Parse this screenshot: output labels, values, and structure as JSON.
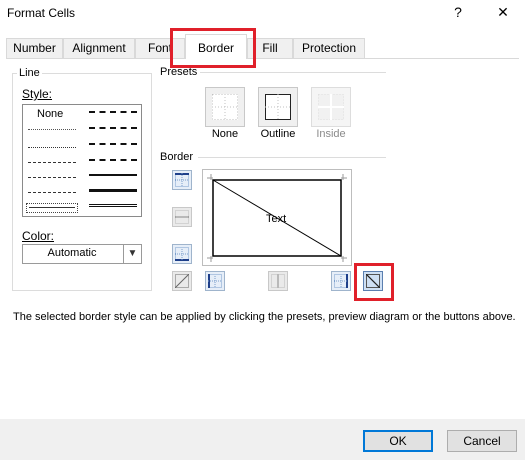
{
  "window": {
    "title": "Format Cells",
    "help_label": "?",
    "close_label": "✕"
  },
  "tabs": [
    {
      "label": "Number"
    },
    {
      "label": "Alignment"
    },
    {
      "label": "Font"
    },
    {
      "label": "Border"
    },
    {
      "label": "Fill"
    },
    {
      "label": "Protection"
    }
  ],
  "active_tab": "Border",
  "line_group": {
    "label": "Line",
    "style_label": "Style:",
    "none_label": "None",
    "color_label": "Color:",
    "color_value": "Automatic"
  },
  "presets_group": {
    "label": "Presets",
    "items": [
      {
        "label": "None",
        "enabled": true
      },
      {
        "label": "Outline",
        "enabled": true
      },
      {
        "label": "Inside",
        "enabled": false
      }
    ]
  },
  "border_group": {
    "label": "Border",
    "preview_text": "Text"
  },
  "status_text": "The selected border style can be applied by clicking the presets, preview diagram or the buttons above.",
  "buttons": {
    "ok_label": "OK",
    "cancel_label": "Cancel"
  },
  "colors": {
    "highlight": "#e0202a",
    "accent": "#0078d7"
  }
}
